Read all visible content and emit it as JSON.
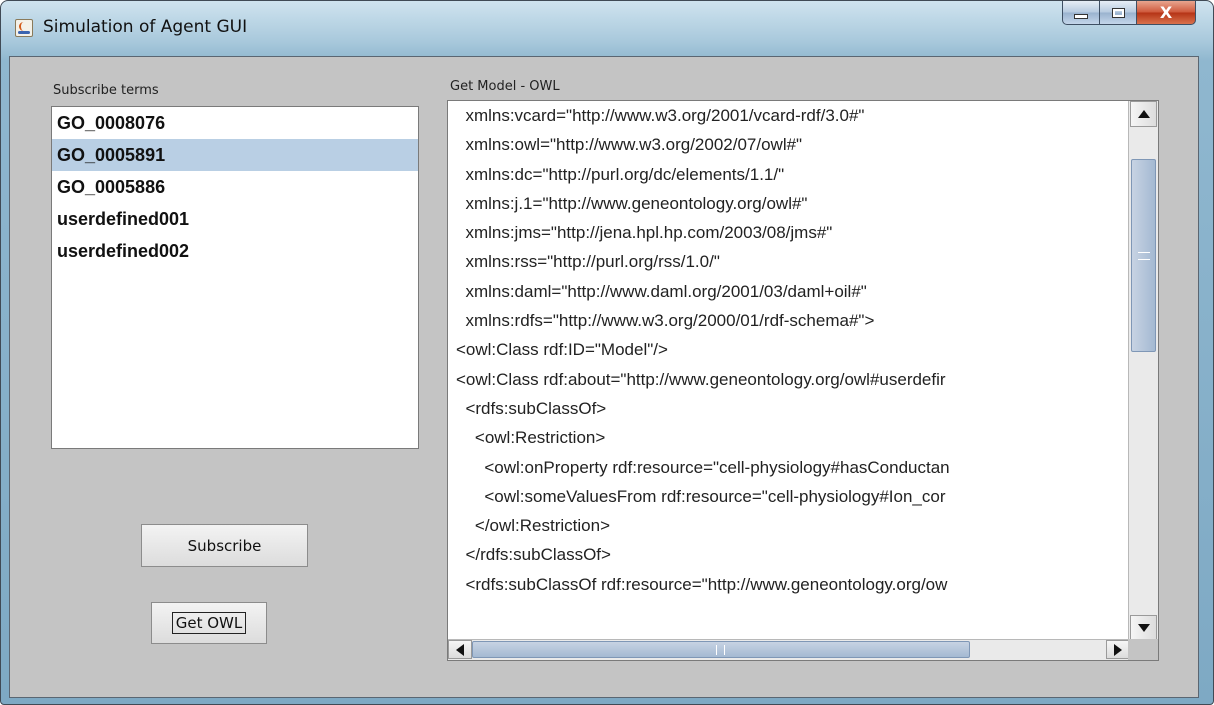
{
  "window": {
    "title": "Simulation of Agent GUI",
    "icon": "java-icon"
  },
  "controls": {
    "minimize_icon": "minimize-icon",
    "maximize_icon": "maximize-icon",
    "close_label": "X"
  },
  "left_panel": {
    "label": "Subscribe terms",
    "terms": [
      "GO_0008076",
      "GO_0005891",
      "GO_0005886",
      "userdefined001",
      "userdefined002"
    ],
    "selected_index": 1,
    "subscribe_button": "Subscribe",
    "get_owl_button": "Get OWL"
  },
  "right_panel": {
    "label": "Get Model - OWL",
    "lines": [
      "  xmlns:vcard=\"http://www.w3.org/2001/vcard-rdf/3.0#\"",
      "  xmlns:owl=\"http://www.w3.org/2002/07/owl#\"",
      "  xmlns:dc=\"http://purl.org/dc/elements/1.1/\"",
      "  xmlns:j.1=\"http://www.geneontology.org/owl#\"",
      "  xmlns:jms=\"http://jena.hpl.hp.com/2003/08/jms#\"",
      "  xmlns:rss=\"http://purl.org/rss/1.0/\"",
      "  xmlns:daml=\"http://www.daml.org/2001/03/daml+oil#\"",
      "  xmlns:rdfs=\"http://www.w3.org/2000/01/rdf-schema#\">",
      "<owl:Class rdf:ID=\"Model\"/>",
      "<owl:Class rdf:about=\"http://www.geneontology.org/owl#userdefir",
      "  <rdfs:subClassOf>",
      "    <owl:Restriction>",
      "      <owl:onProperty rdf:resource=\"cell-physiology#hasConductan",
      "      <owl:someValuesFrom rdf:resource=\"cell-physiology#Ion_cor",
      "    </owl:Restriction>",
      "  </rdfs:subClassOf>",
      "  <rdfs:subClassOf rdf:resource=\"http://www.geneontology.org/ow"
    ]
  }
}
